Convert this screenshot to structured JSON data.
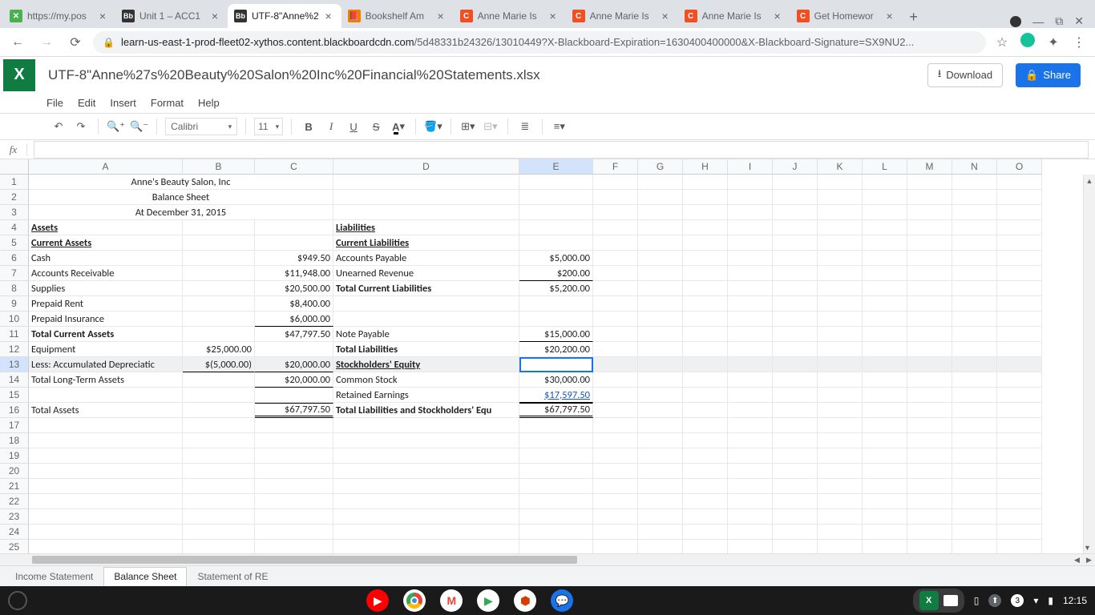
{
  "browser": {
    "tabs": [
      {
        "title": "https://my.pos",
        "fav": "x"
      },
      {
        "title": "Unit 1 – ACC1",
        "fav": "bb"
      },
      {
        "title": "UTF-8\"Anne%2",
        "fav": "bb",
        "active": true
      },
      {
        "title": "Bookshelf Am",
        "fav": "g"
      },
      {
        "title": "Anne Marie Is",
        "fav": "c"
      },
      {
        "title": "Anne Marie Is",
        "fav": "c"
      },
      {
        "title": "Anne Marie Is",
        "fav": "c"
      },
      {
        "title": "Get Homewor",
        "fav": "c"
      }
    ],
    "url_host": "learn-us-east-1-prod-fleet02-xythos.content.blackboardcdn.com",
    "url_path": "/5d48331b24326/13010449?X-Blackboard-Expiration=1630400400000&X-Blackboard-Signature=SX9NU2..."
  },
  "app": {
    "title": "UTF-8\"Anne%27s%20Beauty%20Salon%20Inc%20Financial%20Statements.xlsx",
    "download": "Download",
    "share": "Share",
    "menus": [
      "File",
      "Edit",
      "Insert",
      "Format",
      "Help"
    ],
    "font_name": "Calibri",
    "font_size": "11",
    "fx": "fx"
  },
  "columns": [
    "A",
    "B",
    "C",
    "D",
    "E",
    "F",
    "G",
    "H",
    "I",
    "J",
    "K",
    "L",
    "M",
    "N",
    "O"
  ],
  "rows": [
    {
      "n": 1,
      "A": "Anne's Beauty Salon, Inc",
      "Acls": "c"
    },
    {
      "n": 2,
      "A": "Balance Sheet",
      "Acls": "c"
    },
    {
      "n": 3,
      "A": "At December 31, 2015",
      "Acls": "c"
    },
    {
      "n": 4,
      "A": "Assets",
      "Acls": "b u",
      "D": "Liabilities",
      "Dcls": "b u"
    },
    {
      "n": 5,
      "A": "Current Assets",
      "Acls": "b u",
      "D": "Current Liabilities",
      "Dcls": "b u"
    },
    {
      "n": 6,
      "A": "Cash",
      "C": "$949.50",
      "Ccls": "r",
      "D": "Accounts Payable",
      "E": "$5,000.00",
      "Ecls": "r"
    },
    {
      "n": 7,
      "A": "Accounts Receivable",
      "C": "$11,948.00",
      "Ccls": "r",
      "D": "Unearned Revenue",
      "E": "$200.00",
      "Ecls": "r bb"
    },
    {
      "n": 8,
      "A": "Supplies",
      "C": "$20,500.00",
      "Ccls": "r",
      "D": "Total Current Liabilities",
      "Dcls": "b",
      "E": "$5,200.00",
      "Ecls": "r"
    },
    {
      "n": 9,
      "A": "Prepaid Rent",
      "C": "$8,400.00",
      "Ccls": "r"
    },
    {
      "n": 10,
      "A": "Prepaid Insurance",
      "C": "$6,000.00",
      "Ccls": "r bb"
    },
    {
      "n": 11,
      "A": "Total Current Assets",
      "Acls": "b",
      "C": "$47,797.50",
      "Ccls": "r",
      "D": "Note Payable",
      "E": "$15,000.00",
      "Ecls": "r bb"
    },
    {
      "n": 12,
      "A": "Equipment",
      "B": "$25,000.00",
      "Bcls": "r",
      "D": "Total Liabilities",
      "Dcls": "b",
      "E": "$20,200.00",
      "Ecls": "r"
    },
    {
      "n": 13,
      "A": "Less: Accumulated Depreciatic",
      "B": "$(5,000.00)",
      "Bcls": "r bb",
      "C": "$20,000.00",
      "Ccls": "r bb",
      "D": "Stockholders' Equity",
      "Dcls": "b u",
      "Ecls": "active",
      "sel": true
    },
    {
      "n": 14,
      "A": "Total Long-Term Assets",
      "C": "$20,000.00",
      "Ccls": "r bb",
      "D": "Common Stock",
      "E": "$30,000.00",
      "Ecls": "r"
    },
    {
      "n": 15,
      "D": "Retained Earnings",
      "E": "$17,597.50",
      "Ecls": "r bb blue"
    },
    {
      "n": 16,
      "A": "Total Assets",
      "C": "$67,797.50",
      "Ccls": "r bt dbl",
      "D": "Total Liabilities and Stockholders' Equ",
      "Dcls": "b",
      "E": "$67,797.50",
      "Ecls": "r bt dbl"
    },
    {
      "n": 17
    },
    {
      "n": 18
    },
    {
      "n": 19
    },
    {
      "n": 20
    },
    {
      "n": 21
    },
    {
      "n": 22
    },
    {
      "n": 23
    },
    {
      "n": 24
    },
    {
      "n": 25
    }
  ],
  "sheet_tabs": [
    "Income Statement",
    "Balance Sheet",
    "Statement of RE"
  ],
  "active_sheet": "Balance Sheet",
  "taskbar": {
    "time": "12:15",
    "badge": "3"
  }
}
